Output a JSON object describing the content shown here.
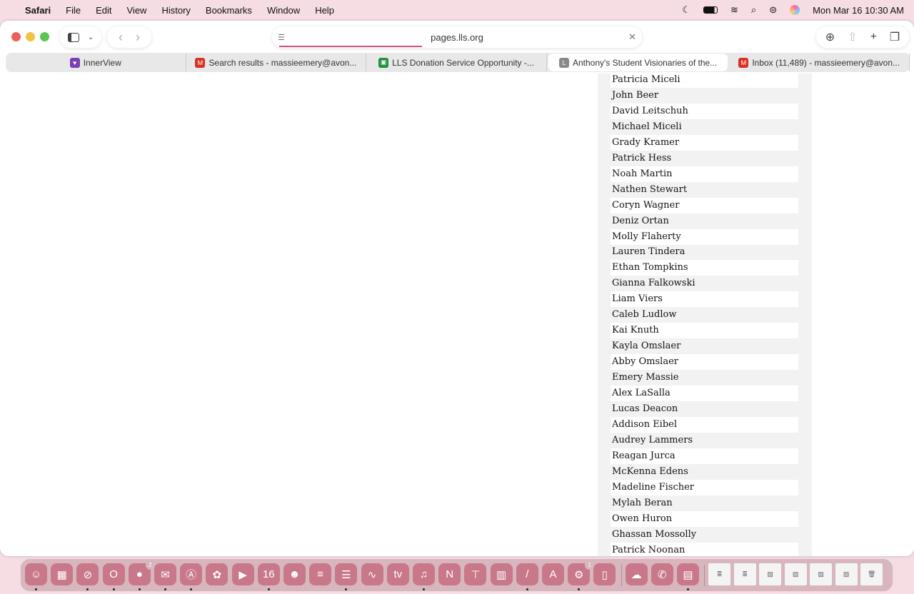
{
  "menubar": {
    "app": "Safari",
    "items": [
      "File",
      "Edit",
      "View",
      "History",
      "Bookmarks",
      "Window",
      "Help"
    ],
    "datetime": "Mon Mar 16  10:30 AM"
  },
  "browser": {
    "url": "pages.lls.org",
    "load_progress": 0.4,
    "tabs": [
      {
        "label": "InnerView",
        "icon": "innerview-icon",
        "color": "#7b3fb5",
        "glyph": "♥"
      },
      {
        "label": "Search results - massieemery@avon...",
        "icon": "gmail-icon",
        "color": "#d93025",
        "glyph": "M"
      },
      {
        "label": "LLS Donation Service Opportunity -...",
        "icon": "classroom-icon",
        "color": "#1e8e3e",
        "glyph": "▣"
      },
      {
        "label": "Anthony's Student Visionaries of the...",
        "icon": "letter-l-icon",
        "color": "#888888",
        "glyph": "L",
        "active": true
      },
      {
        "label": "Inbox (11,489) - massieemery@avon...",
        "icon": "gmail-icon",
        "color": "#d93025",
        "glyph": "M"
      }
    ]
  },
  "names": [
    "Patricia Miceli",
    "John Beer",
    "David Leitschuh",
    "Michael Miceli",
    "Grady Kramer",
    "Patrick Hess",
    "Noah Martin",
    "Nathen Stewart",
    "Coryn Wagner",
    "Deniz Ortan",
    "Molly Flaherty",
    "Lauren Tindera",
    "Ethan Tompkins",
    "Gianna Falkowski",
    "Liam Viers",
    "Caleb Ludlow",
    "Kai Knuth",
    "Kayla Omslaer",
    "Abby Omslaer",
    "Emery Massie",
    "Alex LaSalla",
    "Lucas Deacon",
    "Addison Eibel",
    "Audrey Lammers",
    "Reagan Jurca",
    "McKenna Edens",
    "Madeline Fischer",
    "Mylah Beran",
    "Owen Huron",
    "Ghassan Mossolly",
    "Patrick Noonan"
  ],
  "dock": [
    {
      "name": "finder",
      "g": "☺",
      "run": true
    },
    {
      "name": "launchpad",
      "g": "▦"
    },
    {
      "name": "safari",
      "g": "⊘",
      "run": true
    },
    {
      "name": "opera",
      "g": "O",
      "run": true
    },
    {
      "name": "messages",
      "g": "●",
      "run": true,
      "badge": "2"
    },
    {
      "name": "mail",
      "g": "✉",
      "run": true
    },
    {
      "name": "maps",
      "g": "Ⓐ",
      "run": true
    },
    {
      "name": "photos",
      "g": "✿"
    },
    {
      "name": "facetime",
      "g": "▶"
    },
    {
      "name": "calendar",
      "g": "16",
      "run": true
    },
    {
      "name": "contacts",
      "g": "☻"
    },
    {
      "name": "reminders",
      "g": "≡"
    },
    {
      "name": "notes",
      "g": "☰",
      "run": true
    },
    {
      "name": "freeform",
      "g": "∿"
    },
    {
      "name": "tv",
      "g": "tv"
    },
    {
      "name": "music",
      "g": "♫",
      "run": true
    },
    {
      "name": "news",
      "g": "N"
    },
    {
      "name": "keynote",
      "g": "⊤"
    },
    {
      "name": "numbers",
      "g": "▥"
    },
    {
      "name": "pages",
      "g": "/",
      "run": true
    },
    {
      "name": "app-store",
      "g": "A"
    },
    {
      "name": "system-settings",
      "g": "⚙",
      "run": true,
      "badge": "1"
    },
    {
      "name": "iphone-mirroring",
      "g": "▯"
    },
    {
      "sep": true
    },
    {
      "name": "icloud",
      "g": "☁"
    },
    {
      "name": "phone",
      "g": "✆"
    },
    {
      "name": "printer",
      "g": "▤",
      "run": true
    },
    {
      "sep": true
    },
    {
      "name": "document",
      "g": "≣",
      "doc": true
    },
    {
      "name": "document",
      "g": "≣",
      "doc": true
    },
    {
      "name": "photo-doc",
      "g": "▨",
      "doc": true
    },
    {
      "name": "photo-doc",
      "g": "▨",
      "doc": true
    },
    {
      "name": "photo-doc",
      "g": "▨",
      "doc": true
    },
    {
      "name": "photo-doc",
      "g": "▨",
      "doc": true
    },
    {
      "name": "trash",
      "g": "🗑",
      "doc": true
    }
  ]
}
